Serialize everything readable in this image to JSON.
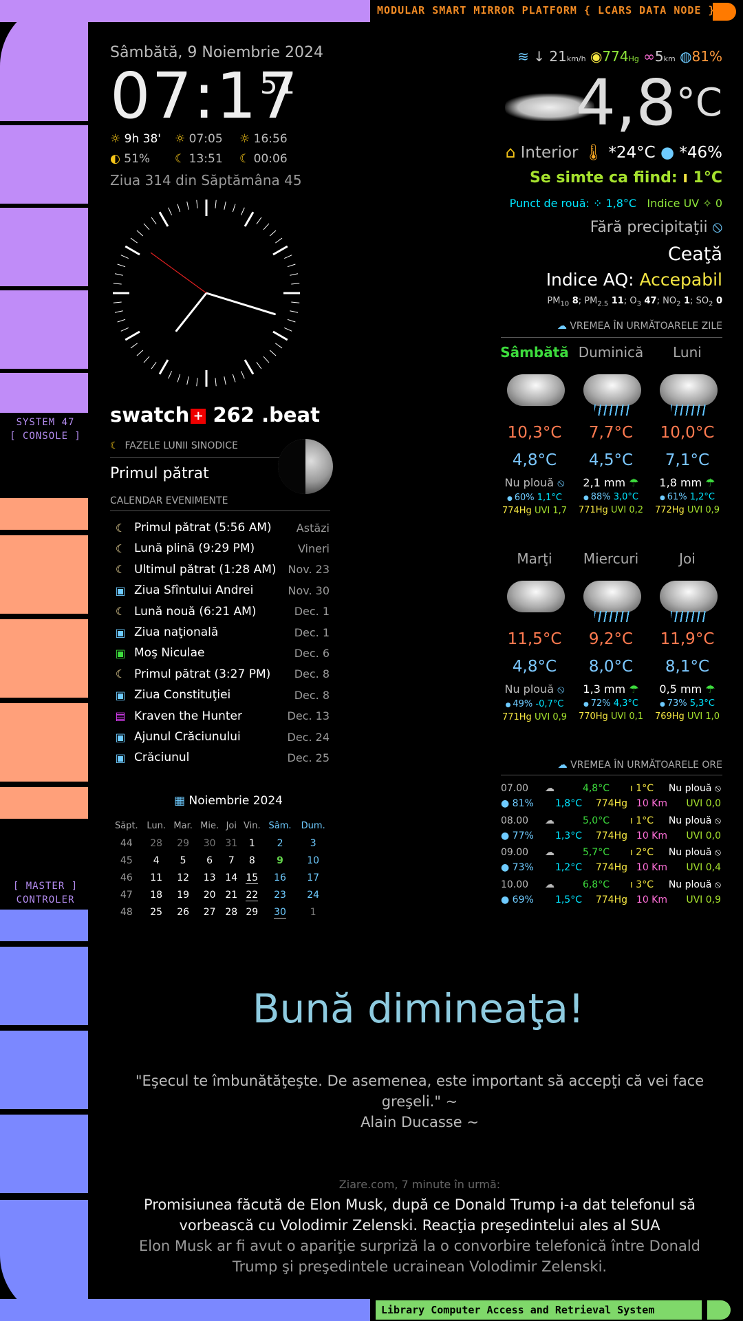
{
  "frame": {
    "top_title": "MODULAR SMART MIRROR PLATFORM { LCARS DATA NODE }",
    "side_label_1": "SYSTEM 47",
    "side_label_2": "[ CONSOLE ]",
    "side_label_3": "[ MASTER ]",
    "side_label_4": "CONTROLER",
    "bottom_title": "Library Computer Access and Retrieval System",
    "colors": {
      "purple": "#c08cf8",
      "salmon": "#ffa07a",
      "blue": "#7b88ff",
      "green": "#7fd86a",
      "orange": "#ff7a00"
    }
  },
  "clock": {
    "date": "Sâmbătă, 9 Noiembrie 2024",
    "time": "07:17",
    "seconds": "51",
    "daylight": "9h 38'",
    "sunrise": "07:05",
    "sunset": "16:56",
    "moon_illum": "51%",
    "moonrise": "13:51",
    "moonset": "00:06",
    "week_info": "Ziua 314 din Săptămâna 45",
    "analog": {
      "hour": 7,
      "minute": 17,
      "second": 51
    },
    "swatch_brand": "swatch",
    "swatch_beat_value": "262",
    "swatch_beat_label": ".beat"
  },
  "moon": {
    "header": "FAZELE LUNII SINODICE",
    "phase": "Primul pătrat"
  },
  "events": {
    "header": "CALENDAR EVENIMENTE",
    "items": [
      {
        "icon": "moon-icon",
        "title": "Primul pătrat (5:56 AM)",
        "date": "Astăzi"
      },
      {
        "icon": "moon-icon",
        "title": "Lună plină (9:29 PM)",
        "date": "Vineri"
      },
      {
        "icon": "moon-icon",
        "title": "Ultimul pătrat (1:28 AM)",
        "date": "Nov. 23"
      },
      {
        "icon": "calendar-check-icon",
        "title": "Ziua Sfîntului Andrei",
        "date": "Nov. 30"
      },
      {
        "icon": "moon-icon",
        "title": "Lună nouă (6:21 AM)",
        "date": "Dec. 1"
      },
      {
        "icon": "calendar-check-icon",
        "title": "Ziua naţională",
        "date": "Dec. 1"
      },
      {
        "icon": "calendar-green-icon",
        "title": "Moş Niculae",
        "date": "Dec. 6"
      },
      {
        "icon": "moon-icon",
        "title": "Primul pătrat (3:27 PM)",
        "date": "Dec. 8"
      },
      {
        "icon": "calendar-check-icon",
        "title": "Ziua Constituţiei",
        "date": "Dec. 8"
      },
      {
        "icon": "film-icon",
        "title": "Kraven the Hunter",
        "date": "Dec. 13"
      },
      {
        "icon": "calendar-check-icon",
        "title": "Ajunul Crăciunului",
        "date": "Dec. 24"
      },
      {
        "icon": "calendar-check-icon",
        "title": "Crăciunul",
        "date": "Dec. 25"
      }
    ]
  },
  "calendar": {
    "title": "Noiembrie 2024",
    "headers": [
      "Săpt.",
      "Lun.",
      "Mar.",
      "Mie.",
      "Joi",
      "Vin.",
      "Sâm.",
      "Dum."
    ],
    "weeks": [
      [
        "44",
        "28",
        "29",
        "30",
        "31",
        "1",
        "2",
        "3"
      ],
      [
        "45",
        "4",
        "5",
        "6",
        "7",
        "8",
        "9",
        "10"
      ],
      [
        "46",
        "11",
        "12",
        "13",
        "14",
        "15",
        "16",
        "17"
      ],
      [
        "47",
        "18",
        "19",
        "20",
        "21",
        "22",
        "23",
        "24"
      ],
      [
        "48",
        "25",
        "26",
        "27",
        "28",
        "29",
        "30",
        "1"
      ]
    ]
  },
  "weather": {
    "wind_speed": "21",
    "wind_unit": "km/h",
    "pressure": "774",
    "pressure_unit": "Hg",
    "visibility": "5",
    "visibility_unit": "km",
    "humidity": "81%",
    "temp": "4,8",
    "temp_unit": "°C",
    "indoor_label": "Interior",
    "indoor_temp": "*24°C",
    "indoor_hum": "*46%",
    "feels_like": "Se simte ca fiind:",
    "feels_value": "1°C",
    "dew_label": "Punct de rouă:",
    "dew_value": "1,8°C",
    "uv_label": "Indice UV",
    "uv_value": "0",
    "precip": "Fără precipitaţii",
    "condition": "Ceaţă",
    "aqi_label": "Indice AQ:",
    "aqi_value": "Accepabil",
    "pollutants": [
      {
        "name": "PM",
        "sub": "10",
        "value": "8"
      },
      {
        "name": "PM",
        "sub": "2.5",
        "value": "11"
      },
      {
        "name": "O",
        "sub": "3",
        "value": "47"
      },
      {
        "name": "NO",
        "sub": "2",
        "value": "1"
      },
      {
        "name": "SO",
        "sub": "2",
        "value": "0"
      }
    ]
  },
  "forecast": {
    "header": "VREMEA ÎN URMĂTOARELE ZILE",
    "days": [
      {
        "day": "Sâmbătă",
        "icon": "cloudy",
        "hi": "10,3°C",
        "lo": "4,8°C",
        "precip": "Nu plouă",
        "hum": "60%",
        "dew": "1,1°C",
        "pres": "774Hg",
        "uv": "UVI 1,7"
      },
      {
        "day": "Duminică",
        "icon": "rain",
        "hi": "7,7°C",
        "lo": "4,5°C",
        "precip": "2,1 mm",
        "hum": "88%",
        "dew": "3,0°C",
        "pres": "771Hg",
        "uv": "UVI 0,2"
      },
      {
        "day": "Luni",
        "icon": "rain",
        "hi": "10,0°C",
        "lo": "7,1°C",
        "precip": "1,8 mm",
        "hum": "61%",
        "dew": "1,2°C",
        "pres": "772Hg",
        "uv": "UVI 0,9"
      },
      {
        "day": "Marţi",
        "icon": "partly-sunny",
        "hi": "11,5°C",
        "lo": "4,8°C",
        "precip": "Nu plouă",
        "hum": "49%",
        "dew": "-0,7°C",
        "pres": "771Hg",
        "uv": "UVI 0,9"
      },
      {
        "day": "Miercuri",
        "icon": "rain",
        "hi": "9,2°C",
        "lo": "8,0°C",
        "precip": "1,3 mm",
        "hum": "72%",
        "dew": "4,3°C",
        "pres": "770Hg",
        "uv": "UVI 0,1"
      },
      {
        "day": "Joi",
        "icon": "rain",
        "hi": "11,9°C",
        "lo": "8,1°C",
        "precip": "0,5 mm",
        "hum": "73%",
        "dew": "5,3°C",
        "pres": "769Hg",
        "uv": "UVI 1,0"
      }
    ]
  },
  "hourly": {
    "header": "VREMEA ÎN URMĂTOARELE ORE",
    "rows": [
      {
        "time": "07.00",
        "temp": "4,8°C",
        "feels": "1°C",
        "precip": "Nu plouă",
        "hum": "81%",
        "dew": "1,8°C",
        "pres": "774Hg",
        "vis": "10 Km",
        "uv": "UVI 0,0"
      },
      {
        "time": "08.00",
        "temp": "5,0°C",
        "feels": "1°C",
        "precip": "Nu plouă",
        "hum": "77%",
        "dew": "1,3°C",
        "pres": "774Hg",
        "vis": "10 Km",
        "uv": "UVI 0,0"
      },
      {
        "time": "09.00",
        "temp": "5,7°C",
        "feels": "2°C",
        "precip": "Nu plouă",
        "hum": "73%",
        "dew": "1,2°C",
        "pres": "774Hg",
        "vis": "10 Km",
        "uv": "UVI 0,4"
      },
      {
        "time": "10.00",
        "temp": "6,8°C",
        "feels": "3°C",
        "precip": "Nu plouă",
        "hum": "69%",
        "dew": "1,5°C",
        "pres": "774Hg",
        "vis": "10 Km",
        "uv": "UVI 0,9"
      }
    ]
  },
  "greeting": "Bună dimineaţa!",
  "quote": {
    "text": "\"Eşecul te îmbunătăţeşte. De asemenea, este important să accepţi că vei face greşeli.\" ~",
    "author": "Alain Ducasse ~"
  },
  "news": {
    "source": "Ziare.com, 7 minute în urmă:",
    "title": "Promisiunea făcută de Elon Musk, după ce Donald Trump i-a dat telefonul să vorbească cu Volodimir Zelenski. Reacţia preşedintelui ales al SUA",
    "description": "Elon Musk ar fi avut o apariţie surpriză la o convorbire telefonică între Donald Trump şi preşedintele ucrainean Volodimir Zelenski."
  }
}
